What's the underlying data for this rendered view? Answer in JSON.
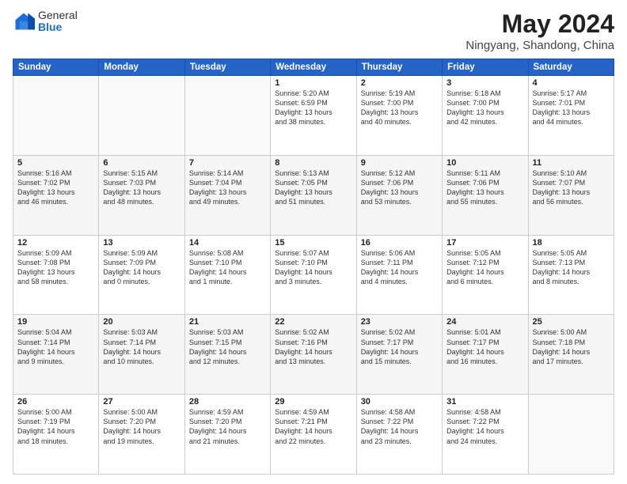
{
  "header": {
    "logo_line1": "General",
    "logo_line2": "Blue",
    "main_title": "May 2024",
    "subtitle": "Ningyang, Shandong, China"
  },
  "days_of_week": [
    "Sunday",
    "Monday",
    "Tuesday",
    "Wednesday",
    "Thursday",
    "Friday",
    "Saturday"
  ],
  "weeks": [
    [
      {
        "day": "",
        "info": ""
      },
      {
        "day": "",
        "info": ""
      },
      {
        "day": "",
        "info": ""
      },
      {
        "day": "1",
        "info": "Sunrise: 5:20 AM\nSunset: 6:59 PM\nDaylight: 13 hours\nand 38 minutes."
      },
      {
        "day": "2",
        "info": "Sunrise: 5:19 AM\nSunset: 7:00 PM\nDaylight: 13 hours\nand 40 minutes."
      },
      {
        "day": "3",
        "info": "Sunrise: 5:18 AM\nSunset: 7:00 PM\nDaylight: 13 hours\nand 42 minutes."
      },
      {
        "day": "4",
        "info": "Sunrise: 5:17 AM\nSunset: 7:01 PM\nDaylight: 13 hours\nand 44 minutes."
      }
    ],
    [
      {
        "day": "5",
        "info": "Sunrise: 5:16 AM\nSunset: 7:02 PM\nDaylight: 13 hours\nand 46 minutes."
      },
      {
        "day": "6",
        "info": "Sunrise: 5:15 AM\nSunset: 7:03 PM\nDaylight: 13 hours\nand 48 minutes."
      },
      {
        "day": "7",
        "info": "Sunrise: 5:14 AM\nSunset: 7:04 PM\nDaylight: 13 hours\nand 49 minutes."
      },
      {
        "day": "8",
        "info": "Sunrise: 5:13 AM\nSunset: 7:05 PM\nDaylight: 13 hours\nand 51 minutes."
      },
      {
        "day": "9",
        "info": "Sunrise: 5:12 AM\nSunset: 7:06 PM\nDaylight: 13 hours\nand 53 minutes."
      },
      {
        "day": "10",
        "info": "Sunrise: 5:11 AM\nSunset: 7:06 PM\nDaylight: 13 hours\nand 55 minutes."
      },
      {
        "day": "11",
        "info": "Sunrise: 5:10 AM\nSunset: 7:07 PM\nDaylight: 13 hours\nand 56 minutes."
      }
    ],
    [
      {
        "day": "12",
        "info": "Sunrise: 5:09 AM\nSunset: 7:08 PM\nDaylight: 13 hours\nand 58 minutes."
      },
      {
        "day": "13",
        "info": "Sunrise: 5:09 AM\nSunset: 7:09 PM\nDaylight: 14 hours\nand 0 minutes."
      },
      {
        "day": "14",
        "info": "Sunrise: 5:08 AM\nSunset: 7:10 PM\nDaylight: 14 hours\nand 1 minute."
      },
      {
        "day": "15",
        "info": "Sunrise: 5:07 AM\nSunset: 7:10 PM\nDaylight: 14 hours\nand 3 minutes."
      },
      {
        "day": "16",
        "info": "Sunrise: 5:06 AM\nSunset: 7:11 PM\nDaylight: 14 hours\nand 4 minutes."
      },
      {
        "day": "17",
        "info": "Sunrise: 5:05 AM\nSunset: 7:12 PM\nDaylight: 14 hours\nand 6 minutes."
      },
      {
        "day": "18",
        "info": "Sunrise: 5:05 AM\nSunset: 7:13 PM\nDaylight: 14 hours\nand 8 minutes."
      }
    ],
    [
      {
        "day": "19",
        "info": "Sunrise: 5:04 AM\nSunset: 7:14 PM\nDaylight: 14 hours\nand 9 minutes."
      },
      {
        "day": "20",
        "info": "Sunrise: 5:03 AM\nSunset: 7:14 PM\nDaylight: 14 hours\nand 10 minutes."
      },
      {
        "day": "21",
        "info": "Sunrise: 5:03 AM\nSunset: 7:15 PM\nDaylight: 14 hours\nand 12 minutes."
      },
      {
        "day": "22",
        "info": "Sunrise: 5:02 AM\nSunset: 7:16 PM\nDaylight: 14 hours\nand 13 minutes."
      },
      {
        "day": "23",
        "info": "Sunrise: 5:02 AM\nSunset: 7:17 PM\nDaylight: 14 hours\nand 15 minutes."
      },
      {
        "day": "24",
        "info": "Sunrise: 5:01 AM\nSunset: 7:17 PM\nDaylight: 14 hours\nand 16 minutes."
      },
      {
        "day": "25",
        "info": "Sunrise: 5:00 AM\nSunset: 7:18 PM\nDaylight: 14 hours\nand 17 minutes."
      }
    ],
    [
      {
        "day": "26",
        "info": "Sunrise: 5:00 AM\nSunset: 7:19 PM\nDaylight: 14 hours\nand 18 minutes."
      },
      {
        "day": "27",
        "info": "Sunrise: 5:00 AM\nSunset: 7:20 PM\nDaylight: 14 hours\nand 19 minutes."
      },
      {
        "day": "28",
        "info": "Sunrise: 4:59 AM\nSunset: 7:20 PM\nDaylight: 14 hours\nand 21 minutes."
      },
      {
        "day": "29",
        "info": "Sunrise: 4:59 AM\nSunset: 7:21 PM\nDaylight: 14 hours\nand 22 minutes."
      },
      {
        "day": "30",
        "info": "Sunrise: 4:58 AM\nSunset: 7:22 PM\nDaylight: 14 hours\nand 23 minutes."
      },
      {
        "day": "31",
        "info": "Sunrise: 4:58 AM\nSunset: 7:22 PM\nDaylight: 14 hours\nand 24 minutes."
      },
      {
        "day": "",
        "info": ""
      }
    ]
  ]
}
